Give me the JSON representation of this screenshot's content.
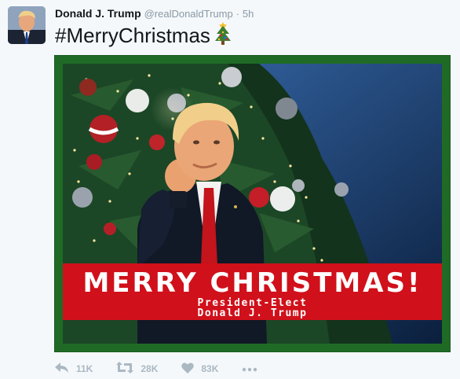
{
  "tweet": {
    "author_name": "Donald J. Trump",
    "handle": "@realDonaldTrump",
    "separator": "·",
    "time": "5h",
    "text": "#MerryChristmas",
    "emoji_icon": "christmas-tree-icon"
  },
  "media": {
    "banner_title": "MERRY CHRISTMAS!",
    "banner_subtitle_line1": "President-Elect",
    "banner_subtitle_line2": "Donald J. Trump",
    "frame_color": "#1f6b26",
    "banner_color": "#d0101a"
  },
  "actions": {
    "reply_count": "11K",
    "retweet_count": "28K",
    "like_count": "83K",
    "icons": [
      "reply-icon",
      "retweet-icon",
      "like-icon",
      "more-icon"
    ],
    "icon_color": "#aab8c2"
  }
}
